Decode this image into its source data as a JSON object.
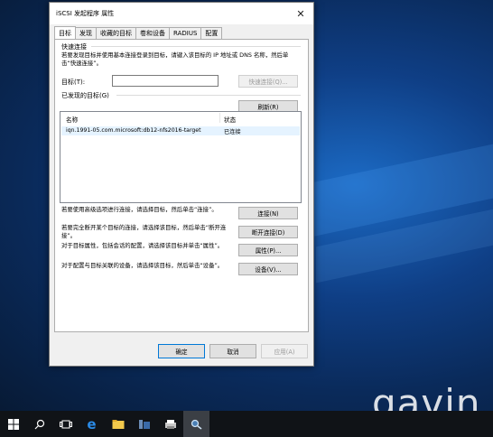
{
  "window": {
    "title": "iSCSI 发起程序 属性",
    "tabs": [
      {
        "label": "目标"
      },
      {
        "label": "发现"
      },
      {
        "label": "收藏的目标"
      },
      {
        "label": "卷和设备"
      },
      {
        "label": "RADIUS"
      },
      {
        "label": "配置"
      }
    ]
  },
  "quick_connect": {
    "heading": "快速连接",
    "description": "若要发现目标并使用基本连接登录到目标，请键入该目标的 IP 地址或 DNS 名称，然后单击“快速连接”。",
    "target_label": "目标(T):",
    "target_value": "",
    "button": "快速连接(Q)..."
  },
  "discovered": {
    "heading": "已发现的目标(G)",
    "refresh_button": "刷新(R)",
    "columns": [
      "名称",
      "状态"
    ],
    "rows": [
      {
        "name": "iqn.1991-05.com.microsoft:db12-nfs2016-target",
        "status": "已连接"
      }
    ]
  },
  "actions": [
    {
      "text": "若要使用高级选项进行连接，请选择目标，然后单击“连接”。",
      "button": "连接(N)"
    },
    {
      "text": "若要完全断开某个目标的连接，请选择该目标，然后单击“断开连接”。",
      "button": "断开连接(D)"
    },
    {
      "text": "对于目标属性，包括会话的配置，请选择该目标并单击“属性”。",
      "button": "属性(P)..."
    },
    {
      "text": "对于配置与目标关联的设备，请选择该目标，然后单击“设备”。",
      "button": "设备(V)..."
    }
  ],
  "footer": {
    "ok": "确定",
    "cancel": "取消",
    "apply": "应用(A)"
  },
  "watermark": "gavin",
  "taskbar": {
    "items": [
      "windows-start",
      "search",
      "task-view",
      "edge",
      "file-explorer",
      "server-manager",
      "printer",
      "iscsi-initiator"
    ]
  }
}
